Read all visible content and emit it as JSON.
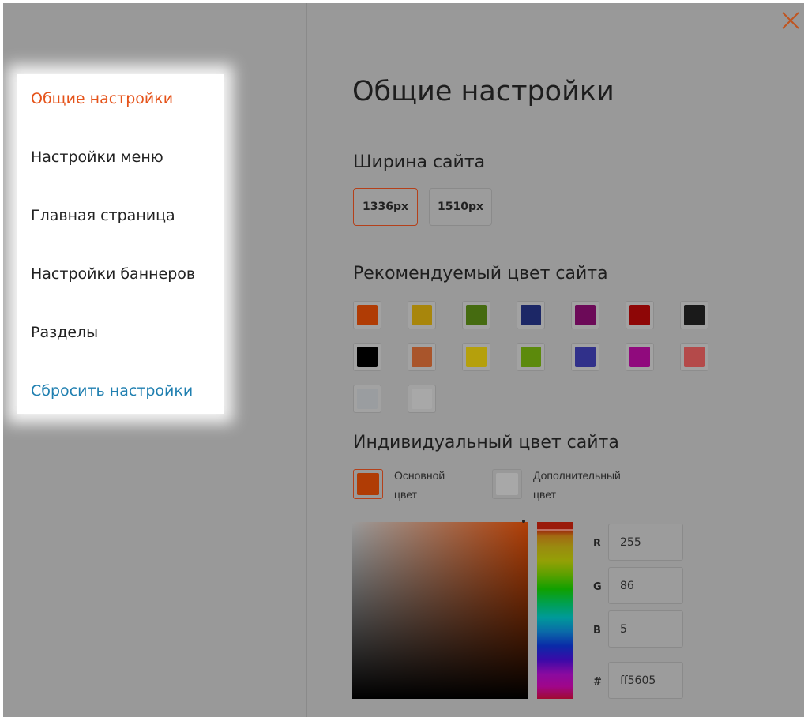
{
  "close_icon": "close-x-icon",
  "menu": {
    "items": [
      {
        "label": "Общие настройки",
        "active": true
      },
      {
        "label": "Настройки меню"
      },
      {
        "label": "Главная страница"
      },
      {
        "label": "Настройки баннеров"
      },
      {
        "label": "Разделы"
      }
    ],
    "reset_label": "Сбросить настройки"
  },
  "main": {
    "title": "Общие настройки",
    "width_section": {
      "title": "Ширина сайта",
      "options": [
        "1336px",
        "1510px"
      ],
      "selected": "1336px"
    },
    "recommended_colors": {
      "title": "Рекомендуемый цвет сайта",
      "colors": [
        "#b03c05",
        "#a8860c",
        "#456b10",
        "#1c2766",
        "#6c0a58",
        "#8e0606",
        "#1a1a1a",
        "#000000",
        "#a9552b",
        "#b5a00c",
        "#5c8a0c",
        "#30308a",
        "#900a7d",
        "#b44a4a",
        "#9a9da0",
        "#a8a8a8"
      ]
    },
    "custom_colors": {
      "title": "Индивидуальный цвет сайта",
      "primary_label_1": "Основной",
      "primary_label_2": "цвет",
      "primary_color": "#b03c05",
      "secondary_label_1": "Дополнительный",
      "secondary_label_2": "цвет",
      "secondary_color": "#a8a8a8"
    },
    "picker": {
      "r_label": "R",
      "r": "255",
      "g_label": "G",
      "g": "86",
      "b_label": "B",
      "b": "5",
      "hex_label": "#",
      "hex": "ff5605"
    }
  }
}
